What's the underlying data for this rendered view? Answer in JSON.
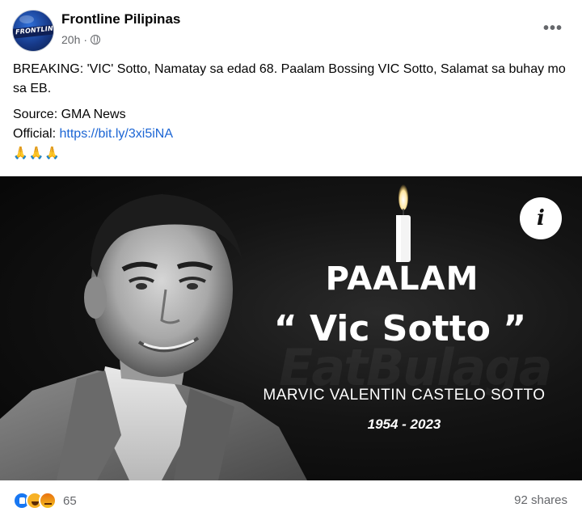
{
  "post": {
    "page_name": "Frontline Pilipinas",
    "avatar_text": "FRONTLINE",
    "time": "20h",
    "audience_icon": "globe-icon",
    "more_icon": "•••",
    "text_line1": "BREAKING: 'VIC' Sotto, Namatay sa edad 68. Paalam Bossing VIC Sotto, Salamat sa buhay mo sa EB.",
    "source": "Source: GMA News",
    "official_label": "Official: ",
    "official_link": "https://bit.ly/3xi5iNA",
    "emoji": "🙏🙏🙏"
  },
  "image": {
    "headline": "PAALAM",
    "name_quoted": "“ Vic Sotto ”",
    "full_name": "MARVIC VALENTIN CASTELO SOTTO",
    "years": "1954 - 2023",
    "info_icon": "i"
  },
  "footer": {
    "reactions": [
      "like-icon",
      "haha-icon",
      "angry-icon"
    ],
    "reaction_count": "65",
    "shares": "92 shares"
  }
}
